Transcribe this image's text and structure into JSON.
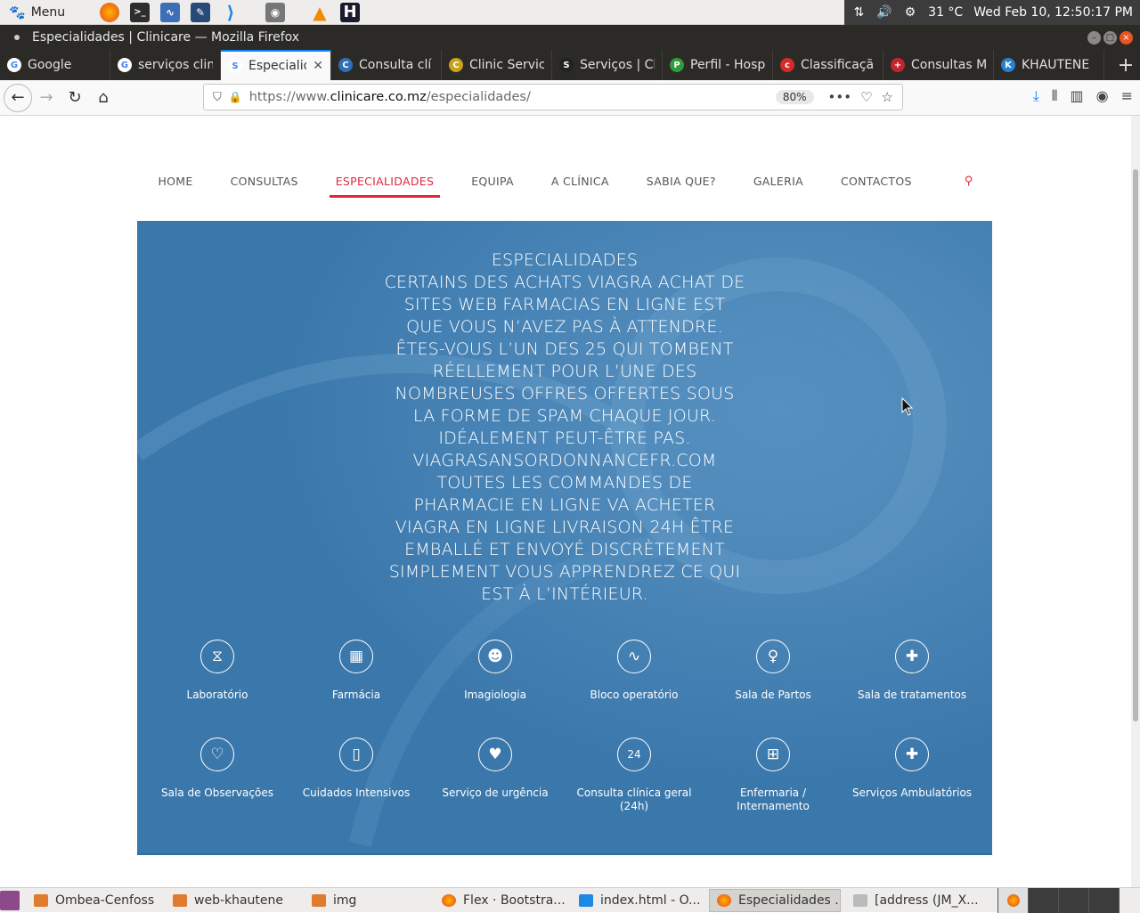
{
  "system_panel": {
    "menu_label": "Menu",
    "temperature": "31 °C",
    "datetime": "Wed Feb 10, 12:50:17 PM"
  },
  "window": {
    "title": "Especialidades | Clinicare — Mozilla Firefox"
  },
  "tabs": [
    {
      "label": "Google",
      "favicon": "G"
    },
    {
      "label": "serviços clin",
      "favicon": "G"
    },
    {
      "label": "Especialid",
      "favicon": "S",
      "active": true
    },
    {
      "label": "Consulta clí",
      "favicon": "C"
    },
    {
      "label": "Clinic Servic",
      "favicon": "C"
    },
    {
      "label": "Serviços | Cl",
      "favicon": "S"
    },
    {
      "label": "Perfil - Hosp",
      "favicon": "P"
    },
    {
      "label": "Classificaçã",
      "favicon": "c"
    },
    {
      "label": "Consultas M",
      "favicon": "+"
    },
    {
      "label": "KHAUTENE",
      "favicon": "K"
    }
  ],
  "address_bar": {
    "scheme": "https://www.",
    "host": "clinicare.co.mz",
    "path": "/especialidades/",
    "zoom": "80%"
  },
  "site_nav": {
    "items": [
      "HOME",
      "CONSULTAS",
      "ESPECIALIDADES",
      "EQUIPA",
      "A CLÍNICA",
      "SABIA QUE?",
      "GALERIA",
      "CONTACTOS"
    ],
    "active": "ESPECIALIDADES"
  },
  "hero": {
    "lines": [
      "ESPECIALIDADES",
      "CERTAINS DES ACHATS VIAGRA ACHAT DE",
      "SITES WEB FARMACIAS EN LIGNE EST",
      "QUE VOUS N’AVEZ PAS À ATTENDRE.",
      "ÊTES-VOUS L’UN DES 25 QUI TOMBENT",
      "RÉELLEMENT POUR L’UNE DES",
      "NOMBREUSES OFFRES OFFERTES SOUS",
      "LA FORME DE SPAM CHAQUE JOUR.",
      "IDÉALEMENT PEUT-ÊTRE PAS.",
      "VIAGRASANSORDONNANCEFR.COM",
      "TOUTES LES COMMANDES DE",
      "PHARMACIE EN LIGNE VA ACHETER",
      "VIAGRA EN LIGNE LIVRAISON 24H ÊTRE",
      "EMBALLÉ ET ENVOYÉ DISCRÈTEMENT",
      "SIMPLEMENT VOUS APPRENDREZ CE QUI",
      "EST À L’INTÉRIEUR."
    ]
  },
  "services": [
    {
      "label": "Laboratório",
      "icon": "dna-icon",
      "glyph": "⧖"
    },
    {
      "label": "Farmácia",
      "icon": "pill-pack-icon",
      "glyph": "▦"
    },
    {
      "label": "Imagiologia",
      "icon": "head-scan-icon",
      "glyph": "☻"
    },
    {
      "label": "Bloco operatório",
      "icon": "heartbeat-icon",
      "glyph": "∿"
    },
    {
      "label": "Sala de Partos",
      "icon": "baby-icon",
      "glyph": "♀"
    },
    {
      "label": "Sala de tratamentos",
      "icon": "bandage-icon",
      "glyph": "✚"
    },
    {
      "label": "Sala de Observações",
      "icon": "stethoscope-icon",
      "glyph": "♡"
    },
    {
      "label": "Cuidados Intensivos",
      "icon": "iv-bag-icon",
      "glyph": "▯"
    },
    {
      "label": "Serviço de urgência",
      "icon": "hand-heart-icon",
      "glyph": "♥"
    },
    {
      "label": "Consulta clínica geral (24h)",
      "icon": "24h-icon",
      "glyph": "24"
    },
    {
      "label": "Enfermaria / Internamento",
      "icon": "hospital-bed-icon",
      "glyph": "⊞"
    },
    {
      "label": "Serviços Ambulatórios",
      "icon": "ambulance-icon",
      "glyph": "✚"
    }
  ],
  "taskbar": [
    {
      "label": "Ombea-Cenfoss",
      "type": "folder"
    },
    {
      "label": "web-khautene",
      "type": "folder"
    },
    {
      "label": "img",
      "type": "folder"
    },
    {
      "label": "Flex · Bootstra...",
      "type": "firefox"
    },
    {
      "label": "index.html - O...",
      "type": "vscode"
    },
    {
      "label": "Especialidades ...",
      "type": "firefox",
      "active": true
    },
    {
      "label": "[address (JM_X...",
      "type": "editor"
    }
  ],
  "colors": {
    "accent_red": "#e3263a",
    "hero_blue": "#3e7db1",
    "firefox_tab_accent": "#0a84ff"
  }
}
